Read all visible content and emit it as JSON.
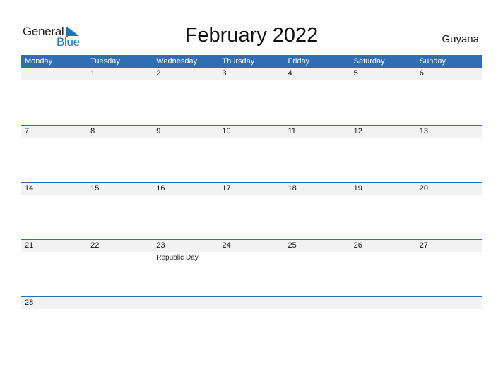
{
  "logo": {
    "text_general": "General",
    "text_blue": "Blue",
    "icon": "logo-triangle-icon"
  },
  "title": "February 2022",
  "country": "Guyana",
  "colors": {
    "header_bg": "#2f6eb5",
    "accent_blue": "#1b75bc",
    "date_strip": "#f2f2f2"
  },
  "weekdays": [
    "Monday",
    "Tuesday",
    "Wednesday",
    "Thursday",
    "Friday",
    "Saturday",
    "Sunday"
  ],
  "weeks": [
    {
      "days": [
        "",
        "1",
        "2",
        "3",
        "4",
        "5",
        "6"
      ],
      "events": [
        "",
        "",
        "",
        "",
        "",
        "",
        ""
      ]
    },
    {
      "days": [
        "7",
        "8",
        "9",
        "10",
        "11",
        "12",
        "13"
      ],
      "events": [
        "",
        "",
        "",
        "",
        "",
        "",
        ""
      ]
    },
    {
      "days": [
        "14",
        "15",
        "16",
        "17",
        "18",
        "19",
        "20"
      ],
      "events": [
        "",
        "",
        "",
        "",
        "",
        "",
        ""
      ]
    },
    {
      "days": [
        "21",
        "22",
        "23",
        "24",
        "25",
        "26",
        "27"
      ],
      "events": [
        "",
        "",
        "Republic Day",
        "",
        "",
        "",
        ""
      ]
    },
    {
      "days": [
        "28",
        "",
        "",
        "",
        "",
        "",
        ""
      ],
      "events": [
        "",
        "",
        "",
        "",
        "",
        "",
        ""
      ]
    }
  ]
}
